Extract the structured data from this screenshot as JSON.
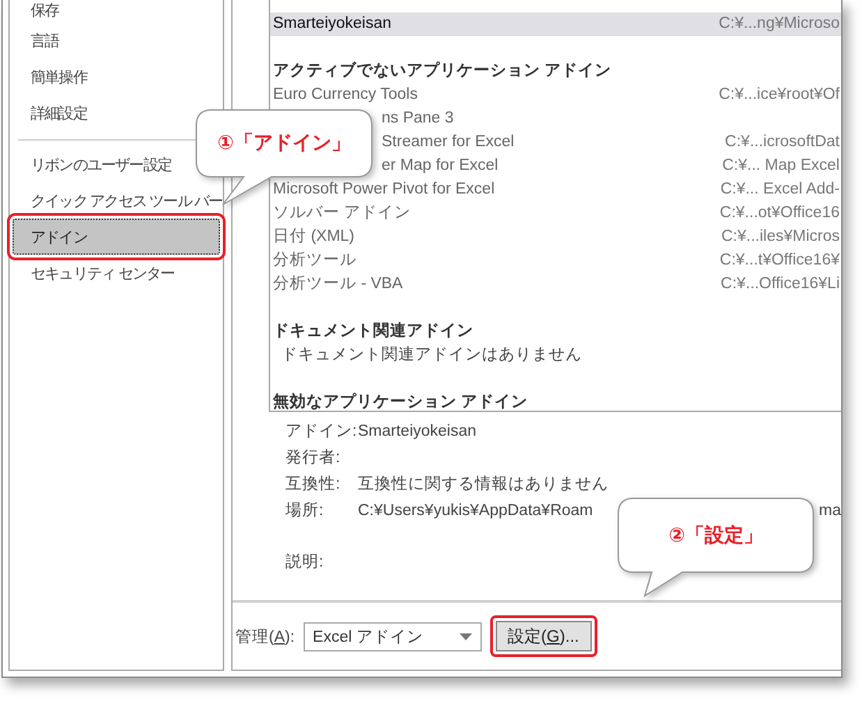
{
  "sidebar": {
    "groups": [
      {
        "items": [
          {
            "label": "保存",
            "selected": false,
            "highlighted": false
          },
          {
            "label": "言語",
            "selected": false,
            "highlighted": false
          },
          {
            "label": "簡単操作",
            "selected": false,
            "highlighted": false
          },
          {
            "label": "詳細設定",
            "selected": false,
            "highlighted": false
          }
        ]
      },
      {
        "items": [
          {
            "label": "リボンのユーザー設定",
            "selected": false,
            "highlighted": false
          },
          {
            "label": "クイック アクセス ツール バー",
            "selected": false,
            "highlighted": false
          },
          {
            "label": "アドイン",
            "selected": true,
            "highlighted": true
          },
          {
            "label": "セキュリティ センター",
            "selected": false,
            "highlighted": false
          }
        ]
      }
    ]
  },
  "addins": {
    "sections": [
      {
        "rows": [
          {
            "name": "Smarteiyokeisan",
            "path": "C:¥...ng¥Microso",
            "selected": true,
            "obscured": false
          }
        ]
      },
      {
        "kind": "inactive",
        "header": "アクティブでないアプリケーション アドイン",
        "rows": [
          {
            "name": "Euro Currency Tools",
            "path": "C:¥...ice¥root¥Of",
            "selected": false,
            "obscured": false
          },
          {
            "name": "ns Pane 3",
            "selected": false,
            "obscured": true
          },
          {
            "name": "Streamer for Excel",
            "path": "C:¥...icrosoftDat",
            "selected": false,
            "obscured": true
          },
          {
            "name": "er Map for Excel",
            "path": "C:¥... Map Excel",
            "selected": false,
            "obscured": true
          },
          {
            "name": "Microsoft Power Pivot for Excel",
            "path": "C:¥... Excel Add-",
            "selected": false,
            "obscured": false
          },
          {
            "name": "ソルバー アドイン",
            "path": "C:¥...ot¥Office16",
            "selected": false,
            "obscured": false
          },
          {
            "name": "日付 (XML)",
            "path": "C:¥...iles¥Micros",
            "selected": false,
            "obscured": false
          },
          {
            "name": "分析ツール",
            "path": "C:¥...t¥Office16¥",
            "selected": false,
            "obscured": false
          },
          {
            "name": "分析ツール - VBA",
            "path": "C:¥...Office16¥Li",
            "selected": false,
            "obscured": false
          }
        ]
      },
      {
        "header": "ドキュメント関連アドイン",
        "message": "ドキュメント関連アドインはありません"
      },
      {
        "header": "無効なアプリケーション アドイン"
      }
    ]
  },
  "details": [
    {
      "label": "アドイン:",
      "value": "Smarteiyokeisan",
      "gap_before": false
    },
    {
      "label": "発行者:",
      "gap_before": false
    },
    {
      "label": "互換性:",
      "value": "互換性に関する情報はありません",
      "gap_before": false
    },
    {
      "label": "場所:",
      "value": "C:¥Users¥yukis¥AppData¥Roam",
      "value_end": "ma",
      "gap_before": false
    },
    {
      "label": "説明:",
      "gap_before": true
    }
  ],
  "manage": {
    "label": {
      "before": "管理(",
      "mnemonic": "A",
      "after": "):"
    },
    "dropdown": "Excel アドイン",
    "button": {
      "before": "設定(",
      "mnemonic": "G",
      "after": ")...",
      "highlighted": true
    }
  },
  "callouts": [
    {
      "text": "①「アドイン」"
    },
    {
      "text": "②「設定」"
    }
  ]
}
